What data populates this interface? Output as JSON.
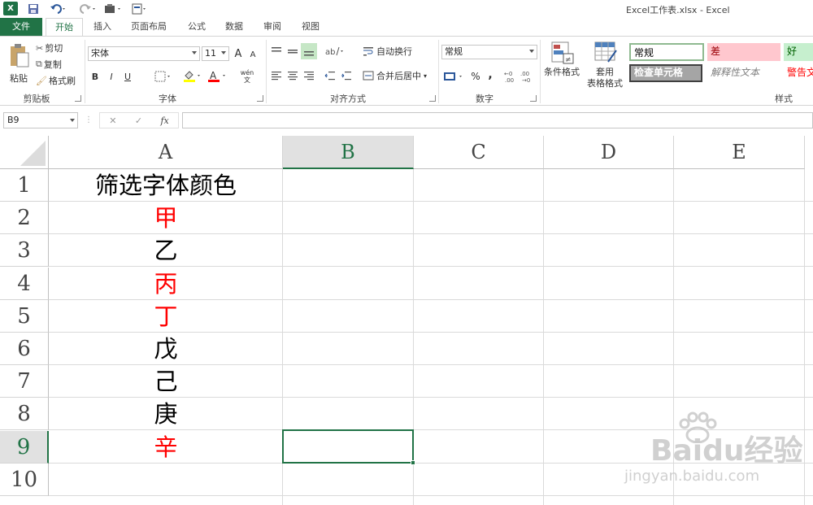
{
  "title_bar": {
    "logo": "X",
    "title": "Excel工作表.xlsx - Excel"
  },
  "tabs": [
    "文件",
    "开始",
    "插入",
    "页面布局",
    "公式",
    "数据",
    "审阅",
    "视图"
  ],
  "ribbon": {
    "clipboard": {
      "paste": "粘贴",
      "cut": "剪切",
      "copy": "复制",
      "format_painter": "格式刷",
      "label": "剪贴板"
    },
    "font": {
      "name": "宋体",
      "size": "11",
      "bold": "B",
      "italic": "I",
      "underline": "U",
      "label": "字体",
      "grow": "A",
      "shrink": "A",
      "phonetic": "wén"
    },
    "alignment": {
      "wrap": "自动换行",
      "merge": "合并后居中",
      "label": "对齐方式"
    },
    "number": {
      "format": "常规",
      "percent": "%",
      "comma": ",",
      "label": "数字"
    },
    "styles": {
      "conditional": "条件格式",
      "table_format_1": "套用",
      "table_format_2": "表格格式",
      "normal": "常规",
      "bad": "差",
      "good": "好",
      "check": "检查单元格",
      "explanatory": "解释性文本",
      "warning": "警告文",
      "label": "样式"
    }
  },
  "formula_bar": {
    "name_box": "B9",
    "fx": "fx",
    "value": ""
  },
  "columns": [
    "A",
    "B",
    "C",
    "D",
    "E"
  ],
  "selected_column": "B",
  "selected_row": "9",
  "rows": [
    "1",
    "2",
    "3",
    "4",
    "5",
    "6",
    "7",
    "8",
    "9",
    "10"
  ],
  "cells_a": [
    {
      "text": "筛选字体颜色",
      "color": "#000000"
    },
    {
      "text": "甲",
      "color": "#ff0000"
    },
    {
      "text": "乙",
      "color": "#000000"
    },
    {
      "text": "丙",
      "color": "#ff0000"
    },
    {
      "text": "丁",
      "color": "#ff0000"
    },
    {
      "text": "戊",
      "color": "#000000"
    },
    {
      "text": "己",
      "color": "#000000"
    },
    {
      "text": "庚",
      "color": "#000000"
    },
    {
      "text": "辛",
      "color": "#ff0000"
    },
    {
      "text": "",
      "color": "#000000"
    }
  ],
  "colors": {
    "accent": "#217346",
    "red": "#ff0000",
    "bad_bg": "#ffc7ce",
    "bad_fg": "#9c0006",
    "good_bg": "#c6efce",
    "good_fg": "#006100"
  },
  "watermark": {
    "brand": "Baidu经验",
    "url": "jingyan.baidu.com"
  }
}
